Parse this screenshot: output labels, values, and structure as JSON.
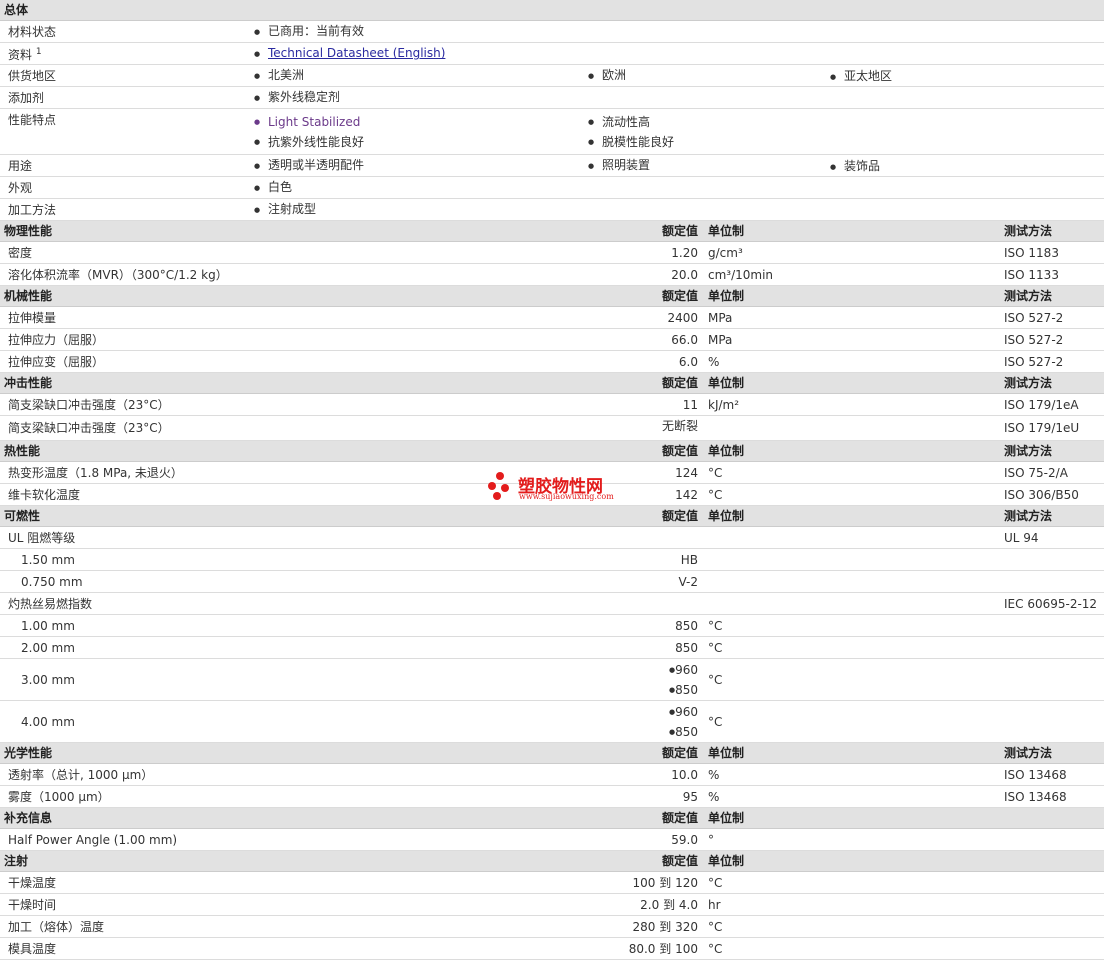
{
  "general": {
    "title": "总体",
    "status_label": "材料状态",
    "status_value": "已商用：当前有效",
    "docs_label": "资料",
    "docs_sup": "1",
    "docs_link": "Technical Datasheet (English)",
    "region_label": "供货地区",
    "regions": [
      "北美洲",
      "欧洲",
      "亚太地区"
    ],
    "additive_label": "添加剂",
    "additive": "紫外线稳定剂",
    "features_label": "性能特点",
    "features": [
      "Light Stabilized",
      "流动性高",
      "抗紫外线性能良好",
      "脱模性能良好"
    ],
    "uses_label": "用途",
    "uses": [
      "透明或半透明配件",
      "照明装置",
      "装饰品"
    ],
    "appearance_label": "外观",
    "appearance": "白色",
    "processing_label": "加工方法",
    "processing": "注射成型"
  },
  "headers": {
    "value": "额定值",
    "unit": "单位制",
    "method": "测试方法"
  },
  "physical": {
    "title": "物理性能",
    "rows": [
      {
        "name": "密度",
        "value": "1.20",
        "unit": "g/cm³",
        "method": "ISO 1183"
      },
      {
        "name": "溶化体积流率（MVR）（300°C/1.2 kg）",
        "value": "20.0",
        "unit": "cm³/10min",
        "method": "ISO 1133"
      }
    ]
  },
  "mechanical": {
    "title": "机械性能",
    "rows": [
      {
        "name": "拉伸模量",
        "value": "2400",
        "unit": "MPa",
        "method": "ISO 527-2"
      },
      {
        "name": "拉伸应力（屈服）",
        "value": "66.0",
        "unit": "MPa",
        "method": "ISO 527-2"
      },
      {
        "name": "拉伸应变（屈服）",
        "value": "6.0",
        "unit": "%",
        "method": "ISO 527-2"
      }
    ]
  },
  "impact": {
    "title": "冲击性能",
    "rows": [
      {
        "name": "简支梁缺口冲击强度（23°C）",
        "value": "11",
        "unit": "kJ/m²",
        "method": "ISO 179/1eA"
      },
      {
        "name": "简支梁缺口冲击强度（23°C）",
        "value": "无断裂",
        "unit": "",
        "method": "ISO 179/1eU"
      }
    ]
  },
  "thermal": {
    "title": "热性能",
    "rows": [
      {
        "name": "热变形温度（1.8 MPa, 未退火）",
        "value": "124",
        "unit": "°C",
        "method": "ISO 75-2/A"
      },
      {
        "name": "维卡软化温度",
        "value": "142",
        "unit": "°C",
        "method": "ISO 306/B50"
      }
    ]
  },
  "flammability": {
    "title": "可燃性",
    "ul_label": "UL 阻燃等级",
    "ul_method": "UL 94",
    "ul_rows": [
      {
        "name": "1.50 mm",
        "value": "HB"
      },
      {
        "name": "0.750 mm",
        "value": "V-2"
      }
    ],
    "gwfi_label": "灼热丝易燃指数",
    "gwfi_method": "IEC 60695-2-12",
    "gwfi_rows": [
      {
        "name": "1.00 mm",
        "value": "850",
        "unit": "°C"
      },
      {
        "name": "2.00 mm",
        "value": "850",
        "unit": "°C"
      }
    ],
    "gwfi_multi": [
      {
        "name": "3.00 mm",
        "values": [
          "960",
          "850"
        ],
        "unit": "°C"
      },
      {
        "name": "4.00 mm",
        "values": [
          "960",
          "850"
        ],
        "unit": "°C"
      }
    ]
  },
  "optical": {
    "title": "光学性能",
    "rows": [
      {
        "name": "透射率（总计, 1000 µm）",
        "value": "10.0",
        "unit": "%",
        "method": "ISO 13468"
      },
      {
        "name": "雾度（1000 µm）",
        "value": "95",
        "unit": "%",
        "method": "ISO 13468"
      }
    ]
  },
  "supplemental": {
    "title": "补充信息",
    "rows": [
      {
        "name": "Half Power Angle (1.00 mm)",
        "value": "59.0",
        "unit": "°"
      }
    ]
  },
  "injection": {
    "title": "注射",
    "rows": [
      {
        "name": "干燥温度",
        "low": "100",
        "to": "到",
        "high": "120",
        "unit": "°C"
      },
      {
        "name": "干燥时间",
        "low": "2.0",
        "to": "到",
        "high": "4.0",
        "unit": "hr"
      },
      {
        "name": "加工（熔体）温度",
        "low": "280",
        "to": "到",
        "high": "320",
        "unit": "°C"
      },
      {
        "name": "模具温度",
        "low": "80.0",
        "to": "到",
        "high": "100",
        "unit": "°C"
      }
    ]
  },
  "watermark": {
    "cn": "塑胶物性网",
    "url": "www.sujiaowuxing.com"
  }
}
